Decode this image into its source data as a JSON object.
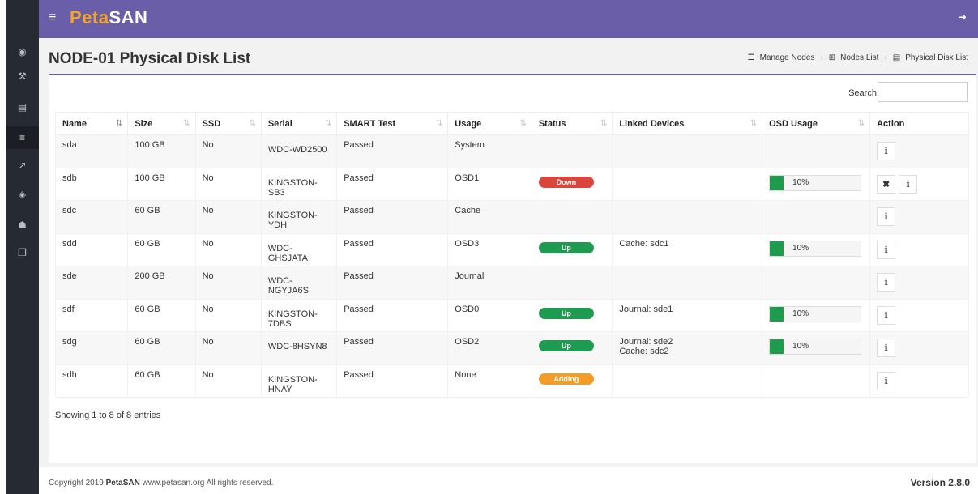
{
  "app": {
    "logo_part1": "Peta",
    "logo_part2": "SAN",
    "menu_icon": "bars-icon",
    "logout_icon": "sign-out-icon"
  },
  "sidebar": {
    "items": [
      {
        "icon": "dashboard-icon",
        "glyph": "◉"
      },
      {
        "icon": "wrench-icon",
        "glyph": "⚒"
      },
      {
        "icon": "storage-icon",
        "glyph": "▤"
      },
      {
        "icon": "list-icon",
        "glyph": "≡",
        "active": true
      },
      {
        "icon": "chart-icon",
        "glyph": "↗"
      },
      {
        "icon": "cube-icon",
        "glyph": "◈"
      },
      {
        "icon": "user-icon",
        "glyph": "☗"
      },
      {
        "icon": "copy-icon",
        "glyph": "❐"
      }
    ]
  },
  "page": {
    "title": "NODE-01 Physical Disk List"
  },
  "breadcrumb": {
    "item1": "Manage Nodes",
    "item2": "Nodes List",
    "item3": "Physical Disk List"
  },
  "search": {
    "label": "Search:",
    "value": ""
  },
  "table": {
    "columns": [
      "Name",
      "Size",
      "SSD",
      "Serial",
      "SMART Test",
      "Usage",
      "Status",
      "Linked Devices",
      "OSD Usage",
      "Action"
    ],
    "rows": [
      {
        "name": "sda",
        "size": "100 GB",
        "ssd": "No",
        "serial": "WDC-WD2500",
        "smart": "Passed",
        "usage": "System",
        "status": "",
        "linked": "",
        "osd": "",
        "actions": [
          "info"
        ]
      },
      {
        "name": "sdb",
        "size": "100 GB",
        "ssd": "No",
        "serial": "KINGSTON-SB3",
        "smart": "Passed",
        "usage": "OSD1",
        "status": "Down",
        "linked": "",
        "osd": "10%",
        "osd_fraction": 0.1,
        "actions": [
          "delete",
          "info"
        ]
      },
      {
        "name": "sdc",
        "size": "60 GB",
        "ssd": "No",
        "serial": "KINGSTON-YDH",
        "smart": "Passed",
        "usage": "Cache",
        "status": "",
        "linked": "",
        "osd": "",
        "actions": [
          "info"
        ]
      },
      {
        "name": "sdd",
        "size": "60 GB",
        "ssd": "No",
        "serial": "WDC-GHSJATA",
        "smart": "Passed",
        "usage": "OSD3",
        "status": "Up",
        "linked": "Cache: sdc1",
        "osd": "10%",
        "osd_fraction": 0.1,
        "actions": [
          "info"
        ]
      },
      {
        "name": "sde",
        "size": "200 GB",
        "ssd": "No",
        "serial": "WDC-NGYJA6S",
        "smart": "Passed",
        "usage": "Journal",
        "status": "",
        "linked": "",
        "osd": "",
        "actions": [
          "info"
        ]
      },
      {
        "name": "sdf",
        "size": "60 GB",
        "ssd": "No",
        "serial": "KINGSTON-7DBS",
        "smart": "Passed",
        "usage": "OSD0",
        "status": "Up",
        "linked": "Journal: sde1",
        "osd": "10%",
        "osd_fraction": 0.1,
        "actions": [
          "info"
        ]
      },
      {
        "name": "sdg",
        "size": "60 GB",
        "ssd": "No",
        "serial": "WDC-8HSYN8",
        "smart": "Passed",
        "usage": "OSD2",
        "status": "Up",
        "linked": "Journal: sde2\nCache: sdc2",
        "osd": "10%",
        "osd_fraction": 0.1,
        "actions": [
          "info"
        ]
      },
      {
        "name": "sdh",
        "size": "60 GB",
        "ssd": "No",
        "serial": "KINGSTON-HNAY",
        "smart": "Passed",
        "usage": "None",
        "status": "Adding",
        "linked": "",
        "osd": "",
        "actions": [
          "info"
        ]
      }
    ]
  },
  "entries_text": "Showing 1 to 8 of 8 entries",
  "footer": {
    "copyright_prefix": "Copyright 2019",
    "brand": "PetaSAN",
    "copyright_suffix": "www.petasan.org All rights reserved.",
    "version": "Version 2.8.0"
  },
  "colors": {
    "topbar": "#6b5ea8",
    "status_down": "#d9463b",
    "status_up": "#1e9a51",
    "status_adding": "#f39c26",
    "osd_fill": "#1f9b4e"
  }
}
